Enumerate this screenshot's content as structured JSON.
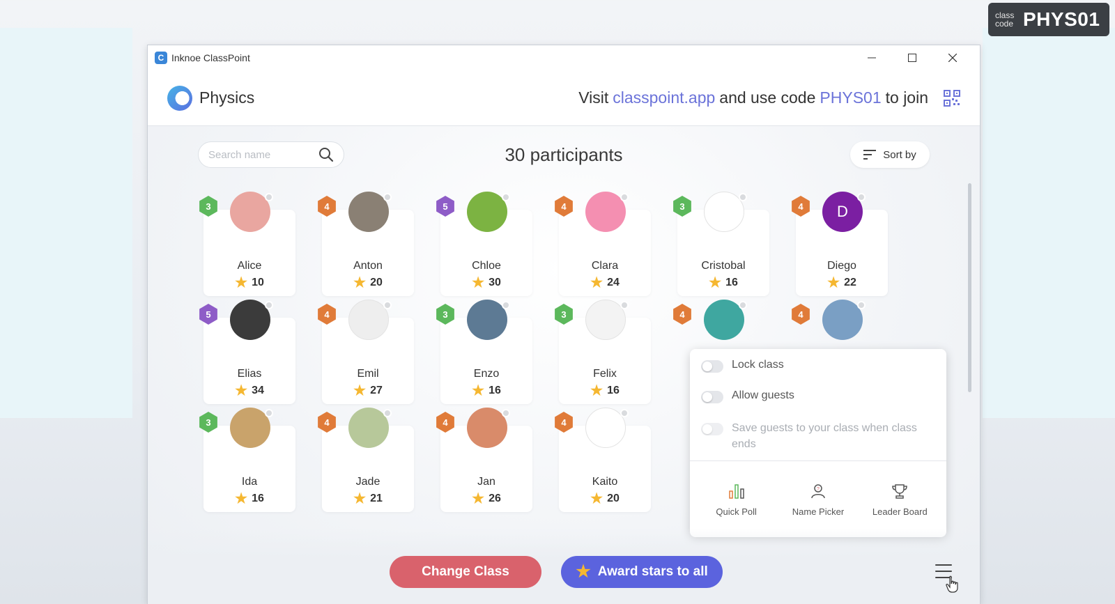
{
  "badge": {
    "small_top": "class",
    "small_bottom": "code",
    "code": "PHYS01"
  },
  "window": {
    "title": "Inknoe ClassPoint",
    "logo_letter": "C"
  },
  "header": {
    "class_name": "Physics",
    "join_prefix": "Visit",
    "join_site": "classpoint.app",
    "join_middle": "and use code",
    "join_code": "PHYS01",
    "join_suffix": "to join"
  },
  "toolbar": {
    "search_placeholder": "Search name",
    "participants": "30 participants",
    "sort_label": "Sort by"
  },
  "participants": [
    {
      "name": "Alice",
      "stars": "10",
      "level": "3",
      "avatar_color": "#e9a6a0"
    },
    {
      "name": "Anton",
      "stars": "20",
      "level": "4",
      "avatar_color": "#8a8074"
    },
    {
      "name": "Chloe",
      "stars": "30",
      "level": "5",
      "avatar_color": "#7cb342"
    },
    {
      "name": "Clara",
      "stars": "24",
      "level": "4",
      "avatar_color": "#f48fb1"
    },
    {
      "name": "Cristobal",
      "stars": "16",
      "level": "3",
      "avatar_color": "#ffffff"
    },
    {
      "name": "Diego",
      "stars": "22",
      "level": "4",
      "avatar_color": "#7b1fa2",
      "avatar_letter": "D"
    },
    {
      "name": "Elias",
      "stars": "34",
      "level": "5",
      "avatar_color": "#3b3b3b"
    },
    {
      "name": "Emil",
      "stars": "27",
      "level": "4",
      "avatar_color": "#eeeeee"
    },
    {
      "name": "Enzo",
      "stars": "16",
      "level": "3",
      "avatar_color": "#5d7a94"
    },
    {
      "name": "Felix",
      "stars": "16",
      "level": "3",
      "avatar_color": "#f3f3f3"
    },
    {
      "name": "",
      "stars": "",
      "level": "4",
      "avatar_color": "#3fa7a0"
    },
    {
      "name": "",
      "stars": "",
      "level": "4",
      "avatar_color": "#7a9fc4"
    },
    {
      "name": "Ida",
      "stars": "16",
      "level": "3",
      "avatar_color": "#c9a36b"
    },
    {
      "name": "Jade",
      "stars": "21",
      "level": "4",
      "avatar_color": "#b7c89a"
    },
    {
      "name": "Jan",
      "stars": "26",
      "level": "4",
      "avatar_color": "#d98b6a"
    },
    {
      "name": "Kaito",
      "stars": "20",
      "level": "4",
      "avatar_color": "#ffffff"
    }
  ],
  "level_colors": {
    "3": "#5cb85c",
    "4": "#e07b39",
    "5": "#8e5cc7"
  },
  "menu": {
    "lock_class": "Lock class",
    "allow_guests": "Allow guests",
    "save_guests": "Save guests to your class when class ends",
    "tools": [
      "Quick Poll",
      "Name Picker",
      "Leader Board"
    ]
  },
  "bottom": {
    "change_class": "Change Class",
    "award_all": "Award stars to all"
  }
}
